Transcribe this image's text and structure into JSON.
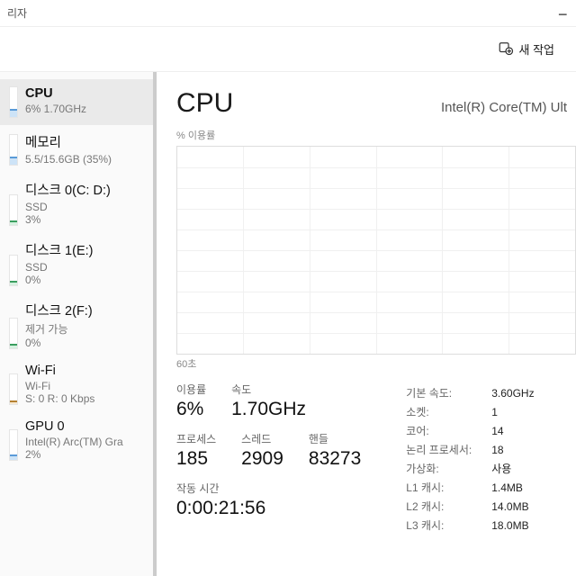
{
  "window": {
    "title": "리자"
  },
  "toolbar": {
    "new_task": "새 작업"
  },
  "sidebar": {
    "items": [
      {
        "name": "CPU",
        "sub": "6%  1.70GHz"
      },
      {
        "name": "메모리",
        "sub": "5.5/15.6GB (35%)"
      },
      {
        "name": "디스크 0(C: D:)",
        "sub": "SSD",
        "third": "3%"
      },
      {
        "name": "디스크 1(E:)",
        "sub": "SSD",
        "third": "0%"
      },
      {
        "name": "디스크 2(F:)",
        "sub": "제거 가능",
        "third": "0%"
      },
      {
        "name": "Wi-Fi",
        "sub": "Wi-Fi",
        "third": "S: 0  R: 0 Kbps"
      },
      {
        "name": "GPU 0",
        "sub": "Intel(R) Arc(TM) Gra",
        "third": "2%"
      }
    ]
  },
  "main": {
    "title": "CPU",
    "cpu_name": "Intel(R) Core(TM) Ult",
    "chart_top": "% 이용률",
    "chart_bottom": "60초",
    "stats": {
      "utilization_label": "이용률",
      "utilization": "6%",
      "speed_label": "속도",
      "speed": "1.70GHz",
      "processes_label": "프로세스",
      "processes": "185",
      "threads_label": "스레드",
      "threads": "2909",
      "handles_label": "핸들",
      "handles": "83273",
      "uptime_label": "작동 시간",
      "uptime": "0:00:21:56"
    },
    "details": [
      {
        "k": "기본 속도:",
        "v": "3.60GHz"
      },
      {
        "k": "소켓:",
        "v": "1"
      },
      {
        "k": "코어:",
        "v": "14"
      },
      {
        "k": "논리 프로세서:",
        "v": "18"
      },
      {
        "k": "가상화:",
        "v": "사용"
      },
      {
        "k": "L1 캐시:",
        "v": "1.4MB"
      },
      {
        "k": "L2 캐시:",
        "v": "14.0MB"
      },
      {
        "k": "L3 캐시:",
        "v": "18.0MB"
      }
    ]
  },
  "chart_data": {
    "type": "line",
    "title": "% 이용률",
    "xlabel": "60초",
    "ylim": [
      0,
      100
    ],
    "series": [
      {
        "name": "CPU",
        "values": [
          6
        ]
      }
    ]
  }
}
